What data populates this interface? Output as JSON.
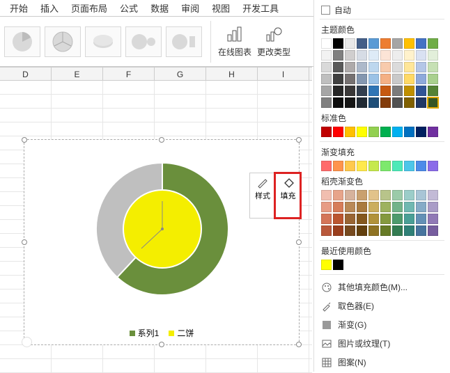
{
  "tabs": [
    "开始",
    "插入",
    "页面布局",
    "公式",
    "数据",
    "审阅",
    "视图",
    "开发工具"
  ],
  "ribbon": {
    "onlineChart": "在线图表",
    "changeType": "更改类型"
  },
  "columns": [
    "D",
    "E",
    "F",
    "G",
    "H",
    "I"
  ],
  "floatTools": {
    "style": "样式",
    "fill": "填充"
  },
  "colorPanel": {
    "auto": "自动",
    "themeColors": "主题颜色",
    "standardColors": "标准色",
    "gradientFill": "渐变填充",
    "docerGradient": "稻壳渐变色",
    "recentColors": "最近使用颜色",
    "moreFill": "其他填充颜色(M)...",
    "eyedropper": "取色器(E)",
    "gradient": "渐变(G)",
    "pictureTexture": "图片或纹理(T)",
    "pattern": "图案(N)"
  },
  "palettes": {
    "themeTop": [
      "#ffffff",
      "#000000",
      "#e8e8e8",
      "#445f88",
      "#5b9bd5",
      "#ed7d31",
      "#a5a5a5",
      "#ffc000",
      "#4472c4",
      "#70ad47"
    ],
    "themeShades": [
      [
        "#f2f2f2",
        "#7f7f7f",
        "#d0cece",
        "#d6dce5",
        "#deebf7",
        "#fce4d6",
        "#ededed",
        "#fff2cc",
        "#d9e1f2",
        "#e2efda"
      ],
      [
        "#d9d9d9",
        "#595959",
        "#aeaaaa",
        "#adb9ca",
        "#bdd7ee",
        "#f8cbad",
        "#dbdbdb",
        "#ffe699",
        "#b4c6e7",
        "#c6e0b4"
      ],
      [
        "#bfbfbf",
        "#404040",
        "#767171",
        "#8497b0",
        "#9bc2e6",
        "#f4b084",
        "#c9c9c9",
        "#ffd966",
        "#8ea9db",
        "#a9d08e"
      ],
      [
        "#a6a6a6",
        "#262626",
        "#3a3838",
        "#333f4f",
        "#2f75b5",
        "#c65911",
        "#7b7b7b",
        "#bf8f00",
        "#305496",
        "#548235"
      ],
      [
        "#808080",
        "#0d0d0d",
        "#161616",
        "#222b35",
        "#1f4e78",
        "#833c0c",
        "#525252",
        "#806000",
        "#203764",
        "#375623"
      ]
    ],
    "standard": [
      "#c00000",
      "#ff0000",
      "#ffc000",
      "#ffff00",
      "#92d050",
      "#00b050",
      "#00b0f0",
      "#0070c0",
      "#002060",
      "#7030a0"
    ],
    "gradient": [
      "#ff6b6b",
      "#ff944d",
      "#ffc94d",
      "#ffe94d",
      "#c6e94d",
      "#7de96d",
      "#4de9b8",
      "#4dc6e9",
      "#4d8be9",
      "#8b6be9"
    ],
    "docer": [
      [
        "#f1beb0",
        "#e7a48a",
        "#d6b29c",
        "#c9a06f",
        "#e2c38a",
        "#b8c48a",
        "#9bcba9",
        "#9bcdc9",
        "#a8c5d6",
        "#c2bad6"
      ],
      [
        "#e79c85",
        "#d67d5a",
        "#b98957",
        "#a97a3f",
        "#cbae5e",
        "#9eb25f",
        "#72b38a",
        "#70b8b1",
        "#85abc7",
        "#a99cc7"
      ],
      [
        "#d47559",
        "#bb5630",
        "#996534",
        "#84581e",
        "#b1923a",
        "#84993f",
        "#4e9a6d",
        "#4a9f96",
        "#6390b6",
        "#9079b6"
      ],
      [
        "#b9583b",
        "#9a3e1d",
        "#774a1f",
        "#63400e",
        "#8f7323",
        "#677b27",
        "#337c52",
        "#2f8077",
        "#47749e",
        "#765d9e"
      ]
    ],
    "recent": [
      "#ffff00",
      "#000000"
    ]
  },
  "chart_data": {
    "type": "pie",
    "title": "",
    "series": [
      {
        "name": "系列1",
        "color": "#6a8f3c",
        "values": [
          62,
          38
        ]
      },
      {
        "name": "二饼",
        "color": "#f4ee00",
        "values": [
          100
        ]
      }
    ],
    "slices_outer": [
      {
        "start": 0,
        "end": 223,
        "color": "#6a8f3c"
      },
      {
        "start": 223,
        "end": 360,
        "color": "#bfbfbf"
      }
    ]
  },
  "legend": {
    "s1": "系列1",
    "s2": "二饼"
  }
}
